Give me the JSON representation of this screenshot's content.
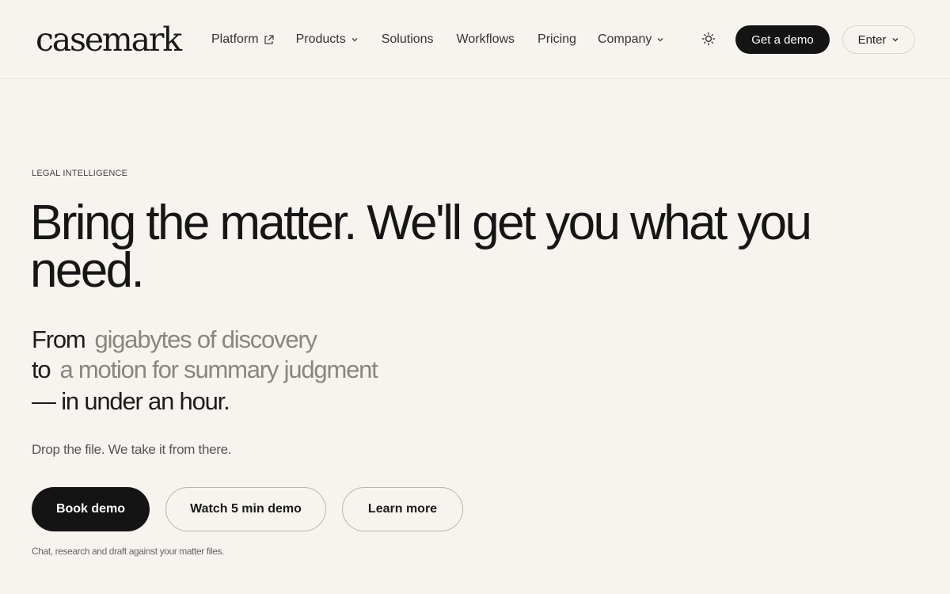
{
  "brand": {
    "name": "casemark"
  },
  "nav": {
    "items": [
      {
        "label": "Platform",
        "icon": "external-link-icon"
      },
      {
        "label": "Products",
        "icon": "chevron-down-icon"
      },
      {
        "label": "Solutions",
        "icon": ""
      },
      {
        "label": "Workflows",
        "icon": ""
      },
      {
        "label": "Pricing",
        "icon": ""
      },
      {
        "label": "Company",
        "icon": "chevron-down-icon"
      }
    ],
    "theme_icon": "sun-icon",
    "get_demo_label": "Get a demo",
    "enter_label": "Enter"
  },
  "hero": {
    "eyebrow": "LEGAL INTELLIGENCE",
    "headline": "Bring the matter. We'll get you what you need.",
    "sub": {
      "from_word": "From",
      "from_value": "gigabytes of discovery",
      "to_word": "to",
      "to_value": "a motion for summary judgment",
      "ending": "— in under an hour."
    },
    "tagline": "Drop the file. We take it from there.",
    "buttons": {
      "book": "Book demo",
      "watch": "Watch 5 min demo",
      "learn": "Learn more"
    },
    "footnote": "Chat, research and draft against your matter files."
  },
  "colors": {
    "background": "#f7f4f0",
    "primary": "#141414",
    "muted_text": "#8a8580"
  }
}
